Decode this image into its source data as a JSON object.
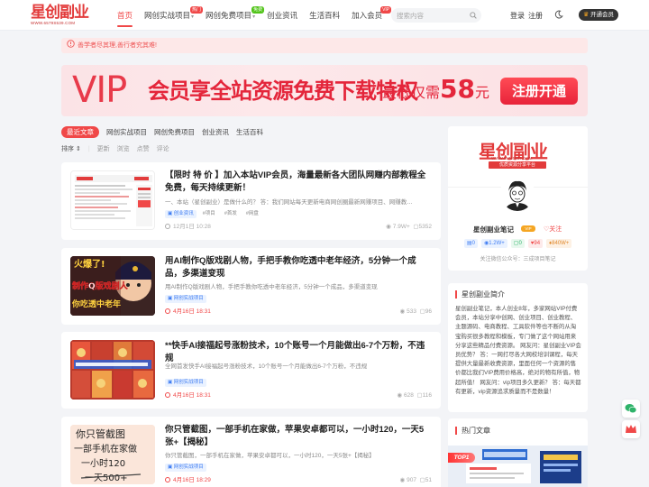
{
  "header": {
    "logo_text": "星创副业",
    "logo_url": "WWW.6579S539.COM",
    "nav": [
      {
        "label": "首页",
        "active": true
      },
      {
        "label": "网创实战项目",
        "badge": "热门",
        "badge_color": "#f04848",
        "dropdown": true
      },
      {
        "label": "网创免费项目",
        "badge": "免费",
        "badge_color": "#52c41a",
        "dropdown": true
      },
      {
        "label": "创业资讯"
      },
      {
        "label": "生活百科"
      },
      {
        "label": "加入会员",
        "badge": "VIP",
        "badge_color": "#f04848"
      }
    ],
    "search_placeholder": "搜索内容",
    "login": "登录",
    "register": "注册",
    "vip_button": "开通会员"
  },
  "notice": "善学者尽其理,善行者究其难!",
  "banner": {
    "vip": "VIP",
    "headline": "会员享全站资源免费下载特权",
    "price_prefix": "最低仅需",
    "price": "58",
    "price_unit": "元",
    "button": "注册开通"
  },
  "tabs": [
    "最近文章",
    "网创实战项目",
    "网创免费项目",
    "创业资讯",
    "生活百科"
  ],
  "sortbar": {
    "label": "排序",
    "options": [
      "更新",
      "浏览",
      "点赞",
      "评论"
    ]
  },
  "posts": [
    {
      "title": "【限时 特 价 】加入本站VIP会员，海量最新各大团队网赚内部教程全免费，每天持续更新！",
      "excerpt": "一、本站（星创副业）是做什么的？ 答：我们网站每天更新电商网创圈最新网赚项目、网赚教…",
      "tags": [
        "创业资讯",
        "#项目",
        "#首发",
        "#网盘"
      ],
      "date": "12月1日 10:28",
      "views": "7.9W+",
      "comments": "5352"
    },
    {
      "title": "用AI制作Q版戏剧人物，手把手教你吃透中老年经济，5分钟一个成品，多渠道变现",
      "excerpt": "用AI制作Q版戏剧人物，手把手教你吃透中老年经济，5分钟一个成品，多渠道变现",
      "tags": [
        "网创实战项目"
      ],
      "date": "4月16日 18:31",
      "views": "533",
      "comments": "96",
      "thumb_text": [
        "火爆了!",
        "制作Q版戏剧人",
        "你吃透中老年"
      ]
    },
    {
      "title": "**快手AI接福起号涨粉技术，10个账号一个月能做出6-7个万粉，不违规",
      "excerpt": "全网首发快手AI接福起号涨粉技术，10个账号一个月能做出6-7个万粉，不违规",
      "tags": [
        "网创实战项目"
      ],
      "date": "4月16日 18:31",
      "views": "628",
      "comments": "116"
    },
    {
      "title": "你只管截图，一部手机在家做，苹果安卓都可以，一小时120，一天5张+【揭秘】",
      "excerpt": "你只管截图，一部手机在家做，苹果安卓都可以，一小时120，一天5张+【揭秘】",
      "tags": [
        "网创实战项目"
      ],
      "date": "4月16日 18:29",
      "views": "907",
      "comments": "51",
      "thumb_text": [
        "你只管截图",
        "一部手机在家做",
        "一小时120",
        "一天500+"
      ]
    }
  ],
  "profile": {
    "cover_logo": "星创副业",
    "cover_url": "WWW.65795539.COM",
    "cover_slogan": "优质资源分享平台",
    "name": "星创副业笔记",
    "badge": "VIP",
    "follow": "关注",
    "stats": [
      {
        "icon": "article",
        "value": "0",
        "color": "#3f7df3",
        "bg": "#eaf2ff"
      },
      {
        "icon": "views",
        "value": "1.2W+",
        "color": "#3f7df3",
        "bg": "#eaf2ff"
      },
      {
        "icon": "comments",
        "value": "0",
        "color": "#2fb36a",
        "bg": "#e8f8ee"
      },
      {
        "icon": "likes",
        "value": "94",
        "color": "#f04848",
        "bg": "#fdeaea"
      },
      {
        "icon": "points",
        "value": "840W+",
        "color": "#e0882b",
        "bg": "#fdf1e4"
      }
    ],
    "desc": "关注微信公众号：三成项目笔记"
  },
  "intro": {
    "title": "星创副业简介",
    "text": "星创副业笔记，本人创业8年，多家网站VIP付费会员，本站分享中创网、创业项目、创业教程、主题源码、电商教程、工具软件等也不断的从淘宝购买很多教程和模板，专门做了这个网站用来分享这些精品付费资源。 网友问：星创副业VIP会员优势？ 答：一网打尽各大网校培训课程，每天提供大量最新收费资源，里面任何一个资源的售价都比我们VIP费用价格高，绝对的物有所值，物超所值！ 网友问：vip项目多久更新？ 答：每天都有更新，vip资源追求质量而不是数量！"
  },
  "hot": {
    "title": "热门文章",
    "top": "TOP1"
  }
}
